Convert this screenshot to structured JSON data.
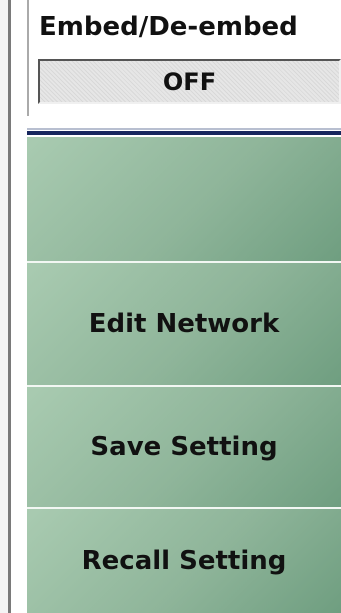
{
  "embed": {
    "title": "Embed/De-embed",
    "value": "OFF"
  },
  "softkeys": [
    {
      "label": ""
    },
    {
      "label": "Edit Network"
    },
    {
      "label": "Save Setting"
    },
    {
      "label": "Recall Setting"
    }
  ],
  "colors": {
    "button_green": "#8fb59a",
    "separator_navy": "#17265e"
  }
}
